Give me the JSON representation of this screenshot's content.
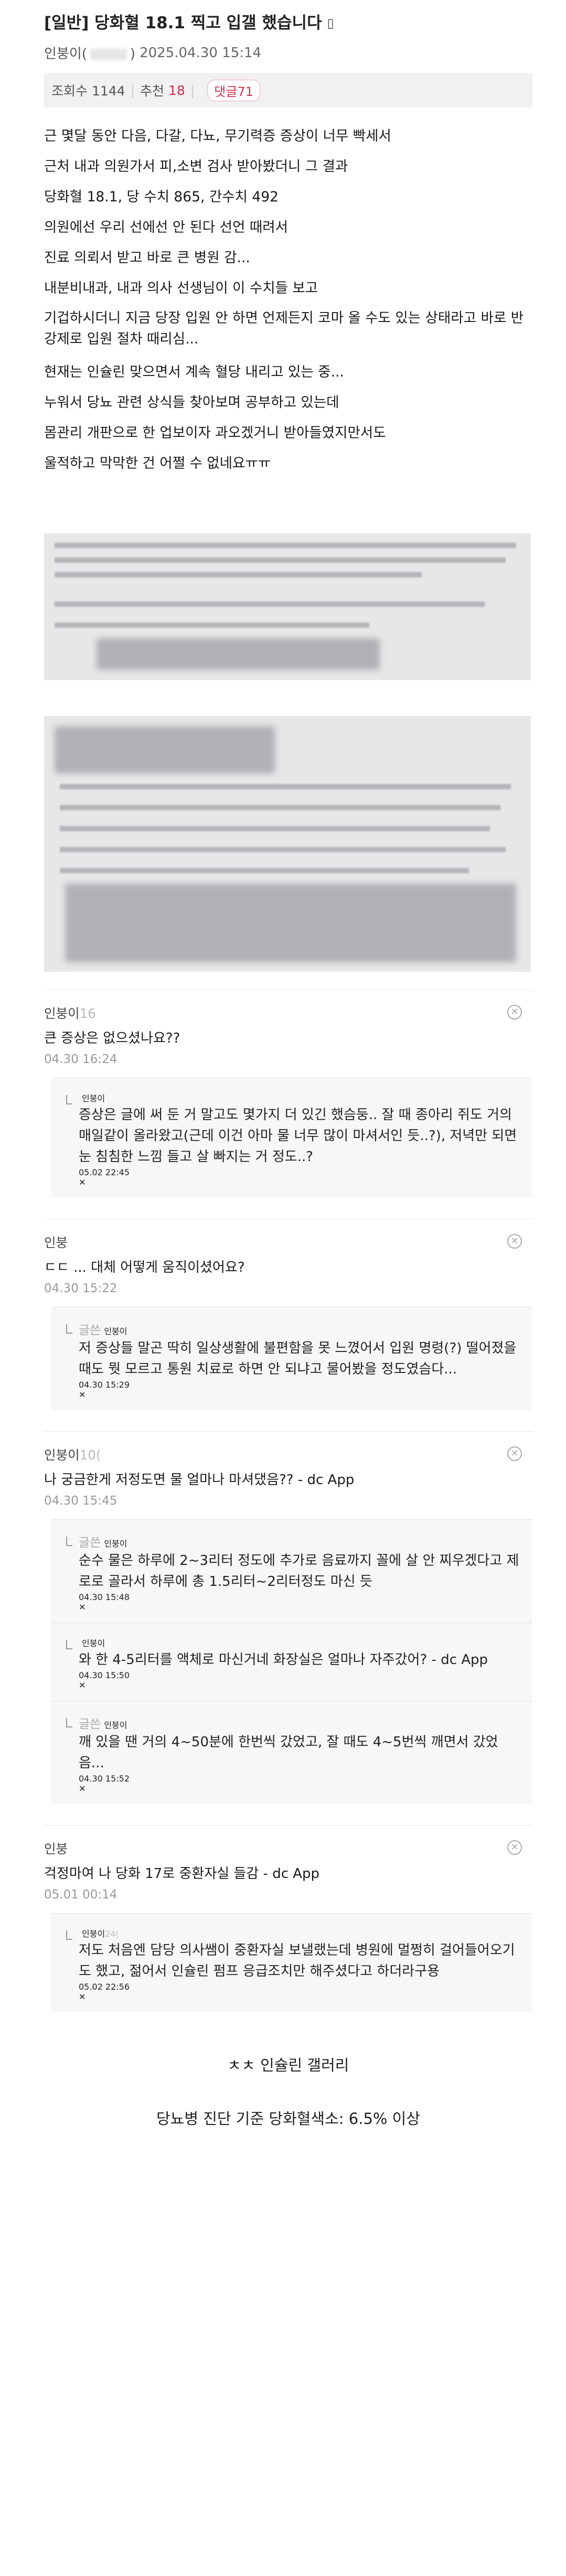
{
  "post": {
    "title": "[일반] 당화혈 18.1 찍고 입갤 했습니다",
    "title_icon": "phone-icon",
    "author": "인붕이(",
    "author_suffix": ")",
    "date": "2025.04.30 15:14",
    "views": "조회수 1144",
    "recommend_label": "추천",
    "recommend_count": "18",
    "comments_badge": "댓글71"
  },
  "content": {
    "lines": [
      "근 몇달 동안 다음, 다갈, 다뇨, 무기력증 증상이 너무 빡세서",
      "근처 내과 의원가서 피,소변 검사 받아봤더니 그 결과",
      "당화혈 18.1, 당 수치 865, 간수치 492",
      "의원에선 우리 선에선 안 된다 선언 때려서",
      "진료 의뢰서 받고 바로 큰 병원 감...",
      "내분비내과, 내과 의사 선생님이 이 수치들 보고",
      "기겁하시더니 지금 당장 입원 안 하면 언제든지 코마 올 수도 있는 상태라고 바로 반강제로 입원 절차 때리심...",
      "현재는 인슐린 맞으면서 계속 혈당 내리고 있는 중...",
      "누워서 당뇨 관련 상식들 찾아보며 공부하고 있는데",
      "몸관리 개판으로 한 업보이자 과오겠거니 받아들였지만서도",
      "울적하고 막막한 건 어쩔 수 없네요ㅠㅠ"
    ]
  },
  "comments": [
    {
      "nick": "인붕이",
      "nick_fade": "16",
      "text": "큰 증상은 없으셨나요??",
      "time": "04.30 16:24",
      "replies": [
        {
          "tag": "",
          "nick": "인붕이",
          "nick_fade": "",
          "text": "증상은 글에 써 둔 거 말고도 몇가지 더 있긴 했슴둥.. 잘 때 종아리 쥐도 거의 매일같이 올라왔고(근데 이건 아마 물 너무 많이 마셔서인 듯..?), 저녁만 되면 눈 침침한 느낌 들고 살 빠지는 거 정도..?",
          "time": "05.02 22:45"
        }
      ]
    },
    {
      "nick": "인붕",
      "nick_fade": "",
      "text": "ㄷㄷ ... 대체 어떻게 움직이셨어요?",
      "time": "04.30 15:22",
      "replies": [
        {
          "tag": "글쓴",
          "nick": "인붕이",
          "nick_fade": "",
          "text": "저 증상들 말곤 딱히 일상생활에 불편함을 못 느꼈어서 입원 명령(?) 떨어졌을 때도 뭣 모르고 통원 치료로 하면 안 되냐고 물어봤을 정도였슴다...",
          "time": "04.30 15:29"
        }
      ]
    },
    {
      "nick": "인붕이",
      "nick_fade": "10(",
      "text": "나 궁금한게 저정도면 물 얼마나 마셔댔음?? - dc App",
      "time": "04.30 15:45",
      "replies": [
        {
          "tag": "글쓴",
          "nick": "인붕이",
          "nick_fade": "",
          "text": "순수 물은 하루에 2~3리터 정도에 추가로 음료까지 꼴에 살 안 찌우겠다고 제로로 골라서 하루에 총 1.5리터~2리터정도 마신 듯",
          "time": "04.30 15:48"
        },
        {
          "tag": "",
          "nick": "인붕이",
          "nick_fade": "",
          "text": "와 한 4-5리터를 액체로 마신거네 화장실은 얼마나 자주갔어? - dc App",
          "time": "04.30 15:50"
        },
        {
          "tag": "글쓴",
          "nick": "인붕이",
          "nick_fade": "",
          "text": "깨 있을 땐 거의 4~50분에 한번씩 갔었고, 잘 때도 4~5번씩 깨면서 갔었음...",
          "time": "04.30 15:52"
        }
      ]
    },
    {
      "nick": "인붕",
      "nick_fade": "",
      "text": "걱정마여 나 당화 17로 중환자실 들감 - dc App",
      "time": "05.01 00:14",
      "replies": [
        {
          "tag": "",
          "nick": "인붕이",
          "nick_fade": "24(",
          "text": "저도 처음엔 담당 의사쌤이 중환자실 보낼랬는데 병원에 멀쩡히 걸어들어오기도 했고, 젊어서 인슐린 펌프 응급조치만 해주셨다고 하더라구용",
          "time": "05.02 22:56"
        }
      ]
    }
  ],
  "footer": {
    "note1": "ㅊㅊ 인슐린 갤러리",
    "note2": "당뇨병 진단 기준 당화혈색소: 6.5% 이상"
  },
  "colors": {
    "accent_red": "#d0304a",
    "stats_bg": "#f1f1f1",
    "reply_bg": "#f7f7f7"
  }
}
